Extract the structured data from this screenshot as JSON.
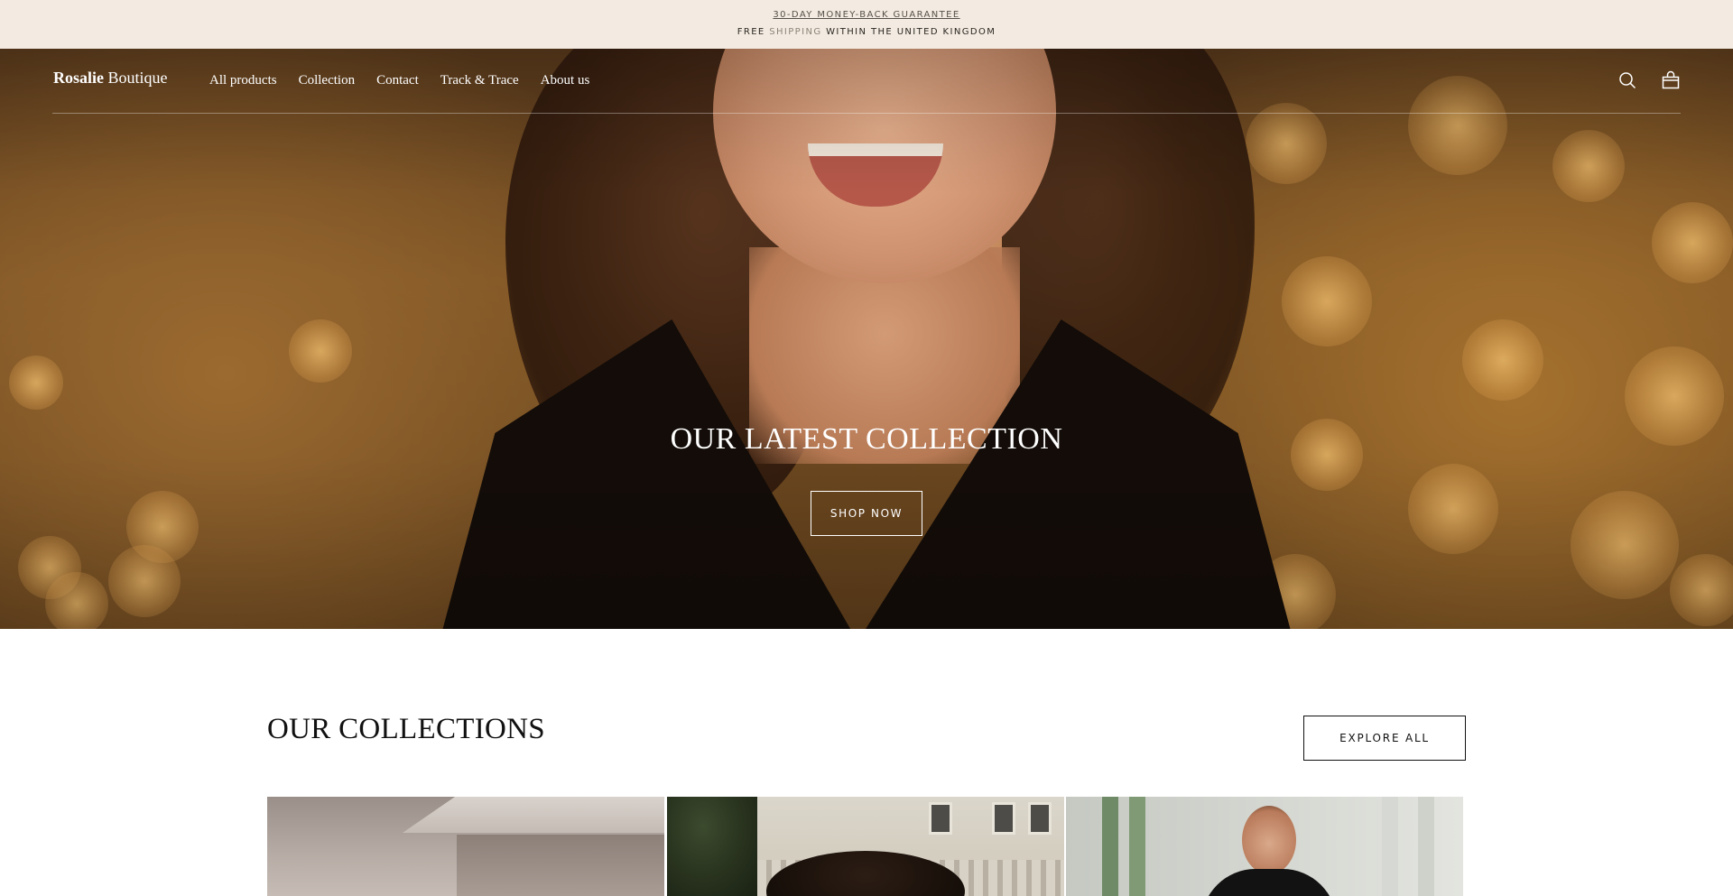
{
  "announcement": {
    "guarantee": "30-DAY MONEY-BACK GUARANTEE",
    "shipping_prefix": "FREE",
    "shipping_highlight": "SHIPPING",
    "shipping_suffix": "WITHIN THE UNITED KINGDOM"
  },
  "header": {
    "logo_bold": "Rosalie",
    "logo_rest": "Boutique",
    "nav": [
      {
        "label": "All products"
      },
      {
        "label": "Collection"
      },
      {
        "label": "Contact"
      },
      {
        "label": "Track & Trace"
      },
      {
        "label": "About us"
      }
    ],
    "icons": {
      "search": "search-icon",
      "cart": "shopping-bag-icon"
    }
  },
  "hero": {
    "title": "OUR LATEST COLLECTION",
    "cta": "SHOP NOW"
  },
  "collections": {
    "title": "OUR COLLECTIONS",
    "explore": "EXPLORE ALL"
  },
  "colors": {
    "announcement_bg": "#f3ebe1",
    "hero_gold": "#a5712e",
    "text_dark": "#111111"
  }
}
